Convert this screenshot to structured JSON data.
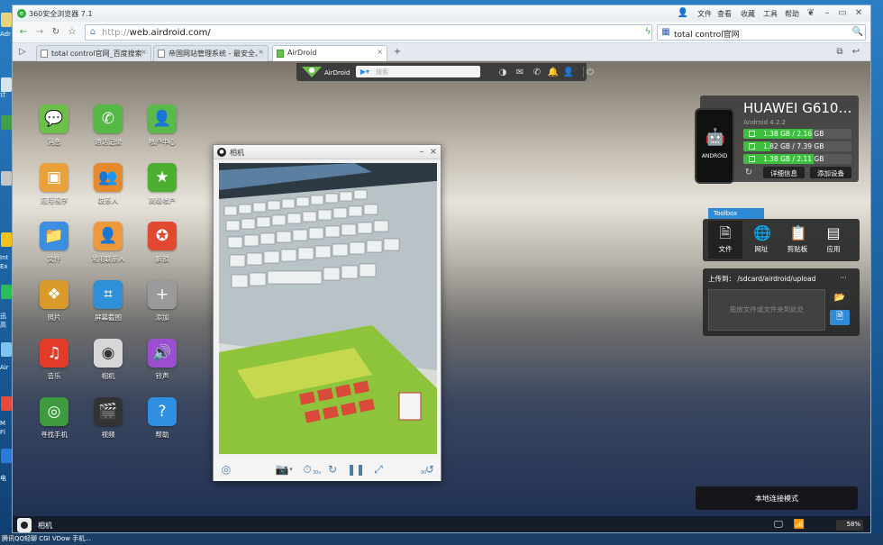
{
  "desktop": {
    "left_labels": [
      "Adr",
      "计",
      "Int",
      "Ex",
      "迅",
      "高",
      "Air",
      "M",
      "Fl",
      "电",
      "腾讯QQ 轻聊",
      "CGI VDow",
      "手机..."
    ],
    "taskbar_text": "腾讯QQ轻聊   CGI VDow   手机..."
  },
  "browser": {
    "title": "360安全浏览器 7.1",
    "menu": [
      "文件",
      "查看",
      "收藏",
      "工具",
      "帮助"
    ],
    "window_controls": [
      "shirt-icon",
      "minimize-icon",
      "maximize-icon",
      "close-icon"
    ],
    "url_prefix": "http://",
    "url_host": "web.airdroid.com/",
    "search_value": "total control官网",
    "tabs": [
      {
        "label": "total control官网_百度搜索",
        "active": false
      },
      {
        "label": "帝国网站管理系统 - 最安全、",
        "active": false
      },
      {
        "label": "AirDroid",
        "active": true
      }
    ],
    "new_tab": "+"
  },
  "airdroid": {
    "logo_text": "AirDroid",
    "search_placeholder": "搜索",
    "top_icons": [
      "dashboard-icon",
      "message-icon",
      "phone-icon",
      "bell-icon",
      "user-icon",
      "power-icon"
    ],
    "apps": [
      {
        "label": "消息",
        "icon": "message-icon",
        "color": "#6cc04a",
        "glyph": "💬"
      },
      {
        "label": "通话记录",
        "icon": "call-log-icon",
        "color": "#55b843",
        "glyph": "✆"
      },
      {
        "label": "帐户中心",
        "icon": "account-icon",
        "color": "#5bb84b",
        "glyph": "👤"
      },
      {
        "label": "应用程序",
        "icon": "apps-icon",
        "color": "#e9a13b",
        "glyph": "▣"
      },
      {
        "label": "联系人",
        "icon": "contacts-icon",
        "color": "#e78a2c",
        "glyph": "👥"
      },
      {
        "label": "高级帐户",
        "icon": "premium-icon",
        "color": "#4caf2f",
        "glyph": "★"
      },
      {
        "label": "文件",
        "icon": "folder-icon",
        "color": "#3b8ee0",
        "glyph": "📁"
      },
      {
        "label": "常用联系人",
        "icon": "frequent-contacts-icon",
        "color": "#ee9a3a",
        "glyph": "👤"
      },
      {
        "label": "解锁",
        "icon": "unlock-icon",
        "color": "#e2472f",
        "glyph": "✪"
      },
      {
        "label": "照片",
        "icon": "photos-icon",
        "color": "#d99a2a",
        "glyph": "❖"
      },
      {
        "label": "屏幕截图",
        "icon": "screenshot-icon",
        "color": "#2f8fd8",
        "glyph": "⌗"
      },
      {
        "label": "添加",
        "icon": "add-icon",
        "color": "#9a9a9a",
        "glyph": "+"
      },
      {
        "label": "音乐",
        "icon": "music-icon",
        "color": "#e23b2a",
        "glyph": "♫"
      },
      {
        "label": "相机",
        "icon": "camera-icon",
        "color": "#d7d7d7",
        "glyph": "◉"
      },
      {
        "label": "铃声",
        "icon": "ringtone-icon",
        "color": "#9b4fd0",
        "glyph": "🔊"
      },
      {
        "label": "寻找手机",
        "icon": "find-phone-icon",
        "color": "#3e9a3e",
        "glyph": "◎"
      },
      {
        "label": "视频",
        "icon": "video-icon",
        "color": "#333333",
        "glyph": "🎬"
      },
      {
        "label": "帮助",
        "icon": "help-icon",
        "color": "#2f8fe0",
        "glyph": "?"
      }
    ],
    "camera_window": {
      "title": "相机",
      "controls": [
        "rotate-camera-icon",
        "snapshot-icon",
        "timer-icon",
        "refresh-icon",
        "pause-icon",
        "fullscreen-icon",
        "rotate-90-icon"
      ],
      "timer_label": "30s",
      "rotate_label": "90"
    },
    "device": {
      "name": "HUAWEI G610…",
      "os": "Android 4.2.2",
      "phone_label": "ANDROID",
      "storage": [
        {
          "text": "1.38 GB / 2.16 GB",
          "fraction": 0.64
        },
        {
          "text": "1.82 GB / 7.39 GB",
          "fraction": 0.25
        },
        {
          "text": "1.38 GB / 2.11 GB",
          "fraction": 0.65
        }
      ],
      "details_btn": "详细信息",
      "add_device_btn": "添加设备"
    },
    "toolbox": {
      "tag": "Toolbox",
      "tools": [
        {
          "label": "文件",
          "icon": "file-icon",
          "glyph": "🗎"
        },
        {
          "label": "网址",
          "icon": "globe-icon",
          "glyph": "🌐"
        },
        {
          "label": "剪贴板",
          "icon": "clipboard-icon",
          "glyph": "📋"
        },
        {
          "label": "应用",
          "icon": "app-icon",
          "glyph": "▤"
        }
      ],
      "upload_label": "上传到：",
      "upload_path": "/sdcard/airdroid/upload",
      "upload_more": "···",
      "drop_hint": "拖放文件或文件夹到此处"
    },
    "local_mode": "本地连接模式",
    "statusbar": {
      "minimized_app": "相机",
      "battery": "58%"
    }
  }
}
